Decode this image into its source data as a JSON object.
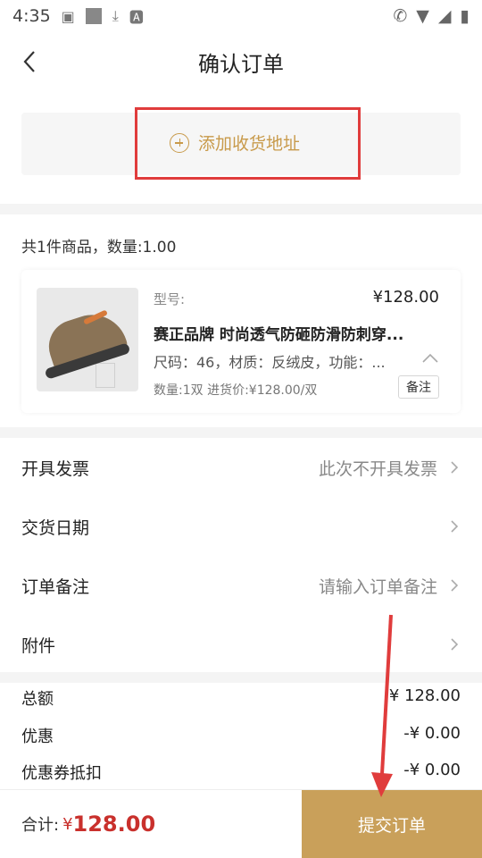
{
  "status_bar": {
    "time": "4:35"
  },
  "header": {
    "title": "确认订单"
  },
  "address": {
    "add_label": "添加收货地址"
  },
  "goods": {
    "summary": "共1件商品，数量:1.00",
    "product": {
      "model_label": "型号:",
      "price": "¥128.00",
      "name": "赛正品牌 时尚透气防砸防滑防刺穿...",
      "spec": "尺码：46，材质：反绒皮，功能：...",
      "qty_line": "数量:1双 进货价:¥128.00/双",
      "note_button": "备注"
    }
  },
  "rows": [
    {
      "label": "开具发票",
      "value": "此次不开具发票"
    },
    {
      "label": "交货日期",
      "value": ""
    },
    {
      "label": "订单备注",
      "value": "请输入订单备注"
    },
    {
      "label": "附件",
      "value": ""
    }
  ],
  "totals": [
    {
      "label": "总额",
      "value": "¥ 128.00"
    },
    {
      "label": "优惠",
      "value": "-¥ 0.00"
    },
    {
      "label": "优惠券抵扣",
      "value": "-¥ 0.00"
    }
  ],
  "bottom": {
    "sum_label": "合计:",
    "sum_currency": "¥",
    "sum_amount": "128.00",
    "submit_label": "提交订单"
  },
  "colors": {
    "accent": "#c9a05a",
    "price_red": "#c9302c",
    "highlight": "#e03c3c"
  }
}
